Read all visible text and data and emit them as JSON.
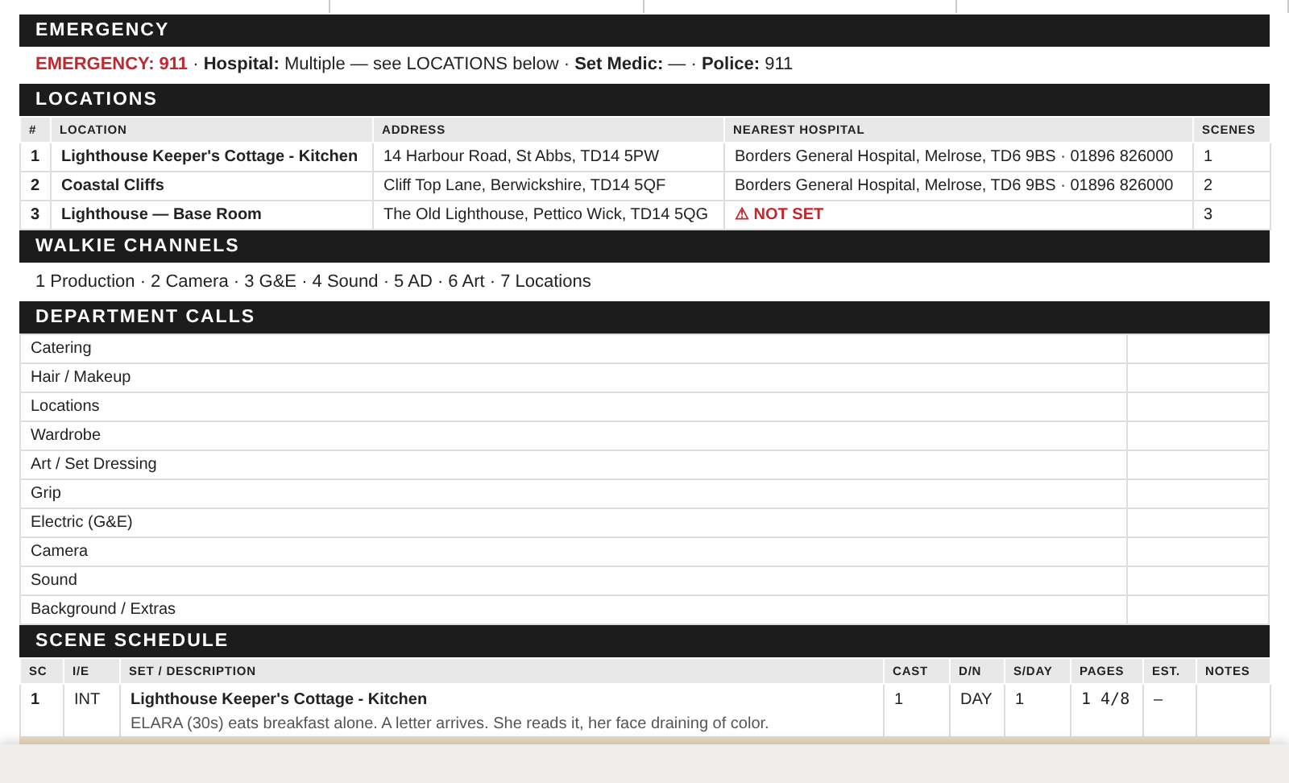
{
  "emergency": {
    "title": "EMERGENCY",
    "line": "**EMERGENCY: 911** · **Hospital:** Multiple — see LOCATIONS below · **Set Medic:** — · **Police:** 911"
  },
  "locations": {
    "title": "LOCATIONS",
    "columns": [
      "#",
      "LOCATION",
      "ADDRESS",
      "NEAREST HOSPITAL",
      "SCENES"
    ],
    "rows": [
      {
        "number": "1",
        "location": "Lighthouse Keeper's Cottage - Kitchen",
        "address": "14 Harbour Road, St Abbs, TD14 5PW",
        "hospital": "Borders General Hospital, Melrose, TD6 9BS · 01896 826000",
        "kind": "normal",
        "scenes": "1"
      },
      {
        "number": "2",
        "location": "Coastal Cliffs",
        "address": "Cliff Top Lane, Berwickshire, TD14 5QF",
        "hospital": "Borders General Hospital, Melrose, TD6 9BS · 01896 826000",
        "kind": "normal",
        "scenes": "2"
      },
      {
        "number": "3",
        "location": "Lighthouse — Base Room",
        "address": "The Old Lighthouse, Pettico Wick, TD14 5QG",
        "hospital": "⚠ NOT SET",
        "kind": "warning",
        "scenes": "3"
      }
    ]
  },
  "walkie_channels": {
    "title": "WALKIE CHANNELS",
    "line": "1 Production · 2 Camera · 3 G&E · 4 Sound · 5 AD · 6 Art · 7 Locations"
  },
  "department_calls": {
    "title": "DEPARTMENT CALLS",
    "departments": [
      "Catering",
      "Hair / Makeup",
      "Locations",
      "Wardrobe",
      "Art / Set Dressing",
      "Grip",
      "Electric (G&E)",
      "Camera",
      "Sound",
      "Background / Extras"
    ]
  },
  "scene_schedule": {
    "title": "SCENE SCHEDULE",
    "columns": [
      "SC",
      "I/E",
      "SET / DESCRIPTION",
      "CAST",
      "D/N",
      "S/DAY",
      "PAGES",
      "EST.",
      "NOTES"
    ],
    "rows": [
      {
        "sc": "1",
        "ie": "INT",
        "set": "Lighthouse Keeper's Cottage - Kitchen",
        "description": "ELARA (30s) eats breakfast alone. A letter arrives. She reads it, her face draining of color.",
        "cast": "1",
        "dn": "DAY",
        "sday": "1",
        "pages": "1 4/8",
        "est": "–"
      }
    ]
  }
}
